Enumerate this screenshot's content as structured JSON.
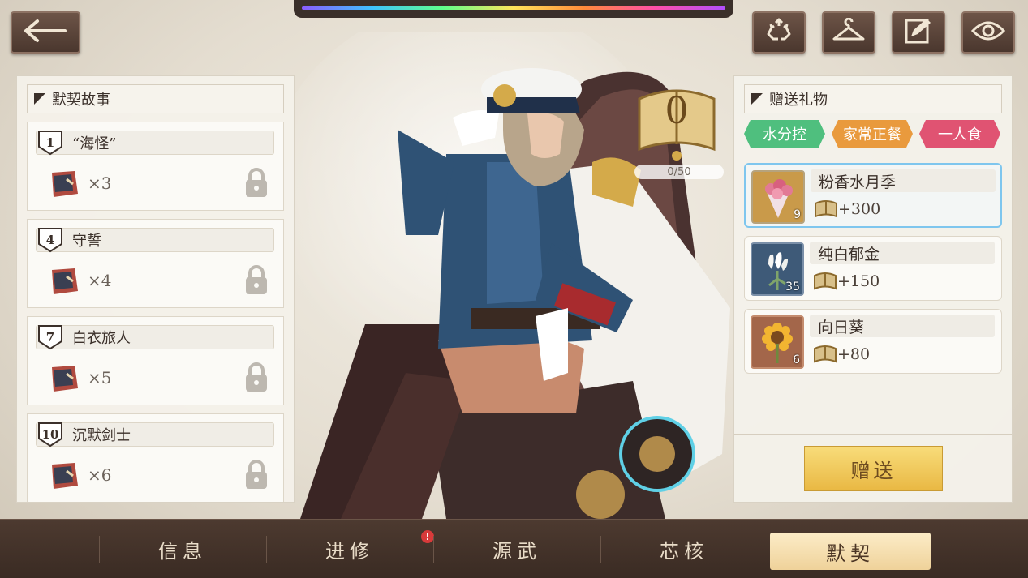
{
  "toolbar": {
    "back_icon": "arrow-left-icon",
    "buttons": [
      {
        "icon": "recycle-icon"
      },
      {
        "icon": "hanger-icon"
      },
      {
        "icon": "edit-note-icon"
      },
      {
        "icon": "eye-icon"
      }
    ]
  },
  "story_panel": {
    "title": "默契故事",
    "stories": [
      {
        "level": "1",
        "title": "“海怪”",
        "count": "×3",
        "locked": true
      },
      {
        "level": "4",
        "title": "守誓",
        "count": "×4",
        "locked": true
      },
      {
        "level": "7",
        "title": "白衣旅人",
        "count": "×5",
        "locked": true
      },
      {
        "level": "10",
        "title": "沉默剑士",
        "count": "×6",
        "locked": true
      }
    ]
  },
  "affinity": {
    "level": "0",
    "progress_text": "0/50"
  },
  "gift_panel": {
    "title": "赠送礼物",
    "tags": [
      {
        "label": "水分控",
        "color": "#4fbf7e"
      },
      {
        "label": "家常正餐",
        "color": "#e99a3d"
      },
      {
        "label": "一人食",
        "color": "#e05372"
      }
    ],
    "gifts": [
      {
        "name": "粉香水月季",
        "qty": "9",
        "value": "+300",
        "selected": true,
        "bg": "#c99a4a"
      },
      {
        "name": "纯白郁金",
        "qty": "35",
        "value": "+150",
        "selected": false,
        "bg": "#3e5a78"
      },
      {
        "name": "向日葵",
        "qty": "6",
        "value": "+80",
        "selected": false,
        "bg": "#a3664a"
      }
    ],
    "give_label": "赠送"
  },
  "bottom_nav": {
    "tabs": [
      {
        "label": "信息",
        "active": false,
        "badge": ""
      },
      {
        "label": "进修",
        "active": false,
        "badge": "!"
      },
      {
        "label": "源武",
        "active": false,
        "badge": ""
      },
      {
        "label": "芯核",
        "active": false,
        "badge": ""
      },
      {
        "label": "默契",
        "active": true,
        "badge": ""
      }
    ]
  }
}
